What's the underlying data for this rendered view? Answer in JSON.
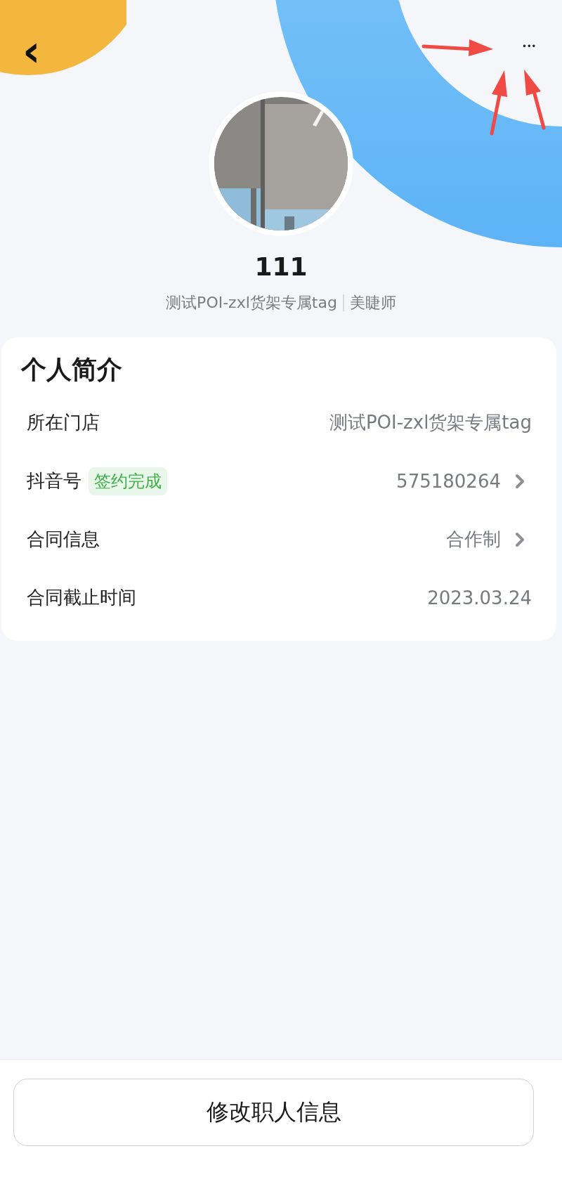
{
  "header": {
    "back": "‹",
    "more": "•••"
  },
  "profile": {
    "name": "111",
    "store": "测试POI-zxl货架专属tag",
    "role": "美睫师"
  },
  "intro_card": {
    "title": "个人简介",
    "rows": [
      {
        "kind": "text",
        "label": "所在门店",
        "value": "测试POI-zxl货架专属tag"
      },
      {
        "kind": "link",
        "label": "抖音号",
        "badge": {
          "text": "签约完成",
          "color": "#3fae49"
        },
        "value": "575180264"
      },
      {
        "kind": "link",
        "label": "合同信息",
        "value": "合作制"
      },
      {
        "kind": "text",
        "label": "合同截止时间",
        "value": "2023.03.24"
      }
    ]
  },
  "footer": {
    "button": "修改职人信息"
  }
}
